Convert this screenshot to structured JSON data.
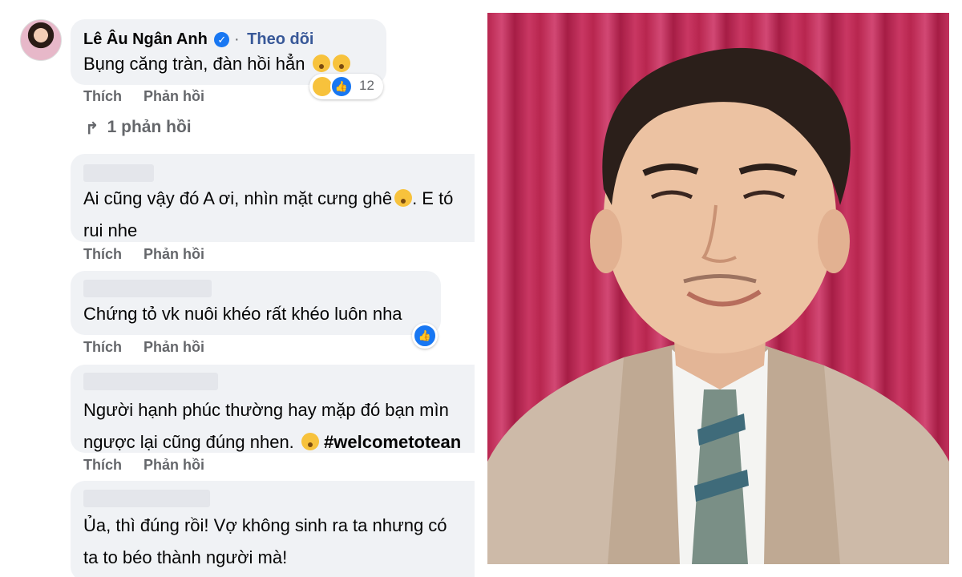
{
  "comments": {
    "main": {
      "author": "Lê Âu Ngân Anh",
      "separator": "·",
      "follow_label": "Theo dõi",
      "text": "Bụng căng tràn, đàn hồi hẳn",
      "reaction_count": "12",
      "replies_label": "1 phản hồi"
    },
    "actions": {
      "like_label": "Thích",
      "reply_label": "Phản hồi"
    },
    "c2": {
      "line1": "Ai cũng vậy đó A ơi, nhìn mặt cưng ghê",
      "line1_end": ". E tó",
      "line2": "rui nhe"
    },
    "c3": {
      "line1": "Chứng tỏ vk nuôi khéo rất khéo luôn nha"
    },
    "c4": {
      "line1": "Người hạnh phúc thường hay mặp đó bạn mìn",
      "line2": "ngược lại cũng đúng nhen.",
      "hashtag": "#welcometotean"
    },
    "c5": {
      "line1": "Ủa, thì đúng rồi! Vợ không sinh ra ta nhưng có",
      "line2": "ta to béo thành người mà!"
    }
  },
  "icons": [
    "avatar",
    "verified-icon",
    "haha-icon",
    "like-icon",
    "reply-arrow-icon",
    "emoji-icon"
  ],
  "colors": {
    "bubble": "#f0f2f5",
    "like_blue": "#1877f2",
    "muted": "#65676b",
    "curtain": "#c93763"
  }
}
